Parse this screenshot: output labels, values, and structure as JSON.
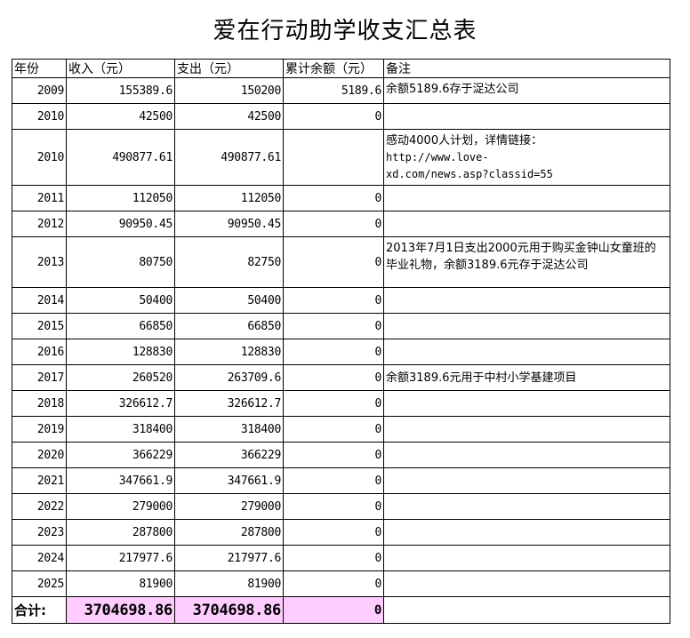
{
  "title": "爱在行动助学收支汇总表",
  "headers": {
    "year": "年份",
    "income": "收入（元）",
    "expense": "支出（元）",
    "balance": "累计余额（元）",
    "note": "备注"
  },
  "rows": [
    {
      "year": "2009",
      "income": "155389.6",
      "expense": "150200",
      "balance": "5189.6",
      "note": "余额5189.6存于浞达公司"
    },
    {
      "year": "2010",
      "income": "42500",
      "expense": "42500",
      "balance": "0",
      "note": ""
    },
    {
      "year": "2010",
      "income": "490877.61",
      "expense": "490877.61",
      "balance": "",
      "note": "感动4000人计划，详情链接：",
      "note2": "http://www.love-",
      "note3": "xd.com/news.asp?classid=55"
    },
    {
      "year": "2011",
      "income": "112050",
      "expense": "112050",
      "balance": "0",
      "note": ""
    },
    {
      "year": "2012",
      "income": "90950.45",
      "expense": "90950.45",
      "balance": "0",
      "note": ""
    },
    {
      "year": "2013",
      "income": "80750",
      "expense": "82750",
      "balance": "0",
      "note": "2013年7月1日支出2000元用于购买金钟山女童班的毕业礼物，余额3189.6元存于浞达公司"
    },
    {
      "year": "2014",
      "income": "50400",
      "expense": "50400",
      "balance": "0",
      "note": ""
    },
    {
      "year": "2015",
      "income": "66850",
      "expense": "66850",
      "balance": "0",
      "note": ""
    },
    {
      "year": "2016",
      "income": "128830",
      "expense": "128830",
      "balance": "0",
      "note": ""
    },
    {
      "year": "2017",
      "income": "260520",
      "expense": "263709.6",
      "balance": "0",
      "note": "余额3189.6元用于中村小学基建项目"
    },
    {
      "year": "2018",
      "income": "326612.7",
      "expense": "326612.7",
      "balance": "0",
      "note": ""
    },
    {
      "year": "2019",
      "income": "318400",
      "expense": "318400",
      "balance": "0",
      "note": ""
    },
    {
      "year": "2020",
      "income": "366229",
      "expense": "366229",
      "balance": "0",
      "note": ""
    },
    {
      "year": "2021",
      "income": "347661.9",
      "expense": "347661.9",
      "balance": "0",
      "note": ""
    },
    {
      "year": "2022",
      "income": "279000",
      "expense": "279000",
      "balance": "0",
      "note": ""
    },
    {
      "year": "2023",
      "income": "287800",
      "expense": "287800",
      "balance": "0",
      "note": ""
    },
    {
      "year": "2024",
      "income": "217977.6",
      "expense": "217977.6",
      "balance": "0",
      "note": ""
    },
    {
      "year": "2025",
      "income": "81900",
      "expense": "81900",
      "balance": "0",
      "note": ""
    }
  ],
  "total": {
    "label": "合计:",
    "income": "3704698.86",
    "expense": "3704698.86",
    "balance": "0"
  },
  "colors": {
    "highlight": "#ffccff",
    "border": "#000000"
  }
}
